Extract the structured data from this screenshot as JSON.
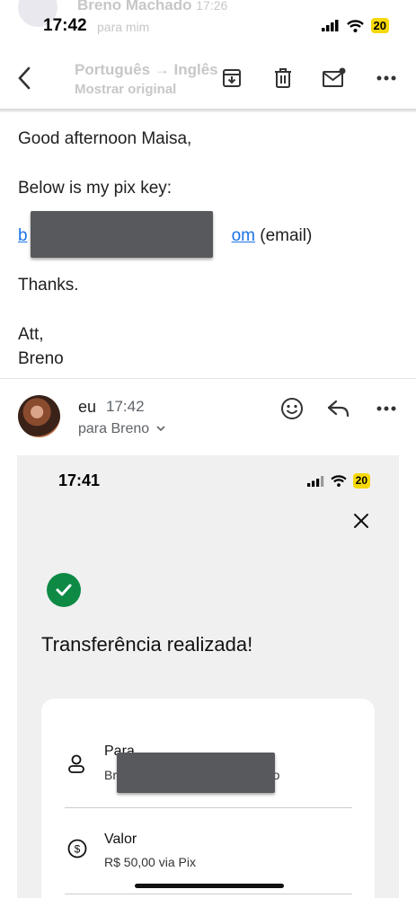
{
  "status_bar": {
    "time": "17:42",
    "battery": "20"
  },
  "background_header": {
    "sender": "Breno Machado",
    "time": "17:26",
    "to": "para mim",
    "translate": "Português → Inglês",
    "show_original": "Mostrar original"
  },
  "toolbar": {
    "back": "back-icon",
    "archive": "archive-icon",
    "delete": "trash-icon",
    "mark_unread": "mail-unread-icon",
    "more": "more-icon"
  },
  "email": {
    "greeting": "Good afternoon Maisa,",
    "line1": "Below is my pix key:",
    "pix_link_start": "b",
    "pix_link_end": "om",
    "pix_suffix": "(email)",
    "thanks": "Thanks.",
    "att": "Att,",
    "signature": "Breno"
  },
  "reply": {
    "from": "eu",
    "time": "17:42",
    "to": "para Breno"
  },
  "attachment_screenshot": {
    "time": "17:41",
    "battery": "20",
    "title": "Transferência realizada!",
    "to_label": "Para",
    "to_value_start": "Br",
    "to_value_end": "ado",
    "amount_label": "Valor",
    "amount_value": "R$ 50,00 via Pix"
  }
}
